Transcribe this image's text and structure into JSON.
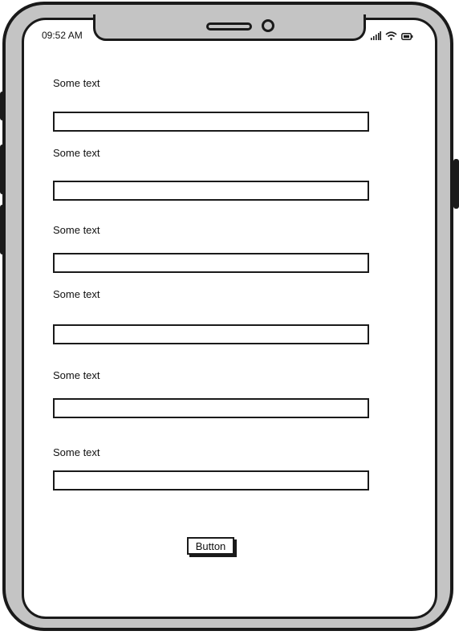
{
  "status_bar": {
    "time": "09:52 AM",
    "icons": [
      "signal-icon",
      "wifi-icon",
      "battery-icon"
    ]
  },
  "form": {
    "fields": [
      {
        "label": "Some text",
        "value": ""
      },
      {
        "label": "Some text",
        "value": ""
      },
      {
        "label": "Some text",
        "value": ""
      },
      {
        "label": "Some text",
        "value": ""
      },
      {
        "label": "Some text",
        "value": ""
      },
      {
        "label": "Some text",
        "value": ""
      }
    ],
    "button_label": "Button"
  },
  "colors": {
    "device_frame": "#c4c4c4",
    "outline": "#1a1a1a",
    "screen": "#ffffff"
  }
}
